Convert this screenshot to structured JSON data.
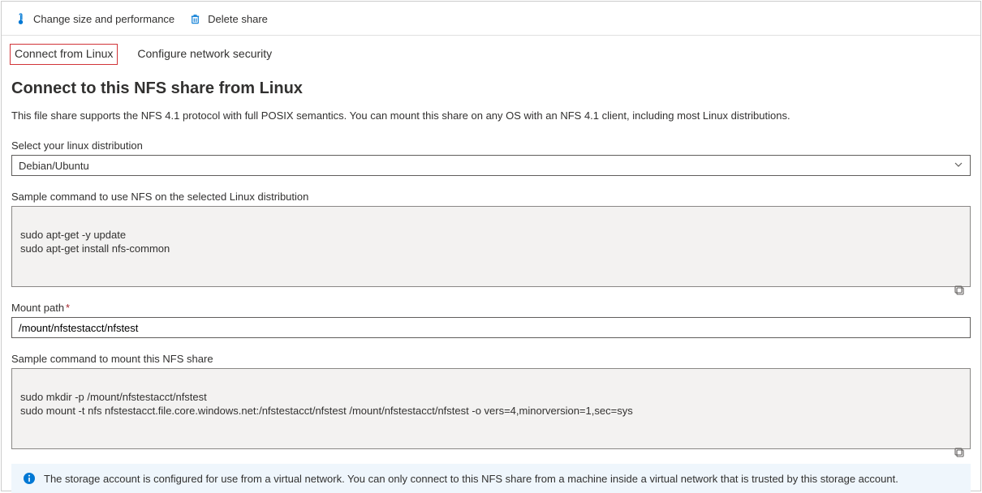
{
  "toolbar": {
    "changeSizeLabel": "Change size and performance",
    "deleteShareLabel": "Delete share"
  },
  "tabs": {
    "connectLinux": "Connect from Linux",
    "networkSecurity": "Configure network security"
  },
  "heading": "Connect to this NFS share from Linux",
  "description": "This file share supports the NFS 4.1 protocol with full POSIX semantics. You can mount this share on any OS with an NFS 4.1 client, including most Linux distributions.",
  "distro": {
    "label": "Select your linux distribution",
    "selected": "Debian/Ubuntu"
  },
  "installCmd": {
    "label": "Sample command to use NFS on the selected Linux distribution",
    "text": "sudo apt-get -y update\nsudo apt-get install nfs-common"
  },
  "mountPath": {
    "label": "Mount path",
    "value": "/mount/nfstestacct/nfstest"
  },
  "mountCmd": {
    "label": "Sample command to mount this NFS share",
    "text": "sudo mkdir -p /mount/nfstestacct/nfstest\nsudo mount -t nfs nfstestacct.file.core.windows.net:/nfstestacct/nfstest /mount/nfstestacct/nfstest -o vers=4,minorversion=1,sec=sys"
  },
  "infoNote": "The storage account is configured for use from a virtual network. You can only connect to this NFS share from a machine inside a virtual network that is trusted by this storage account."
}
